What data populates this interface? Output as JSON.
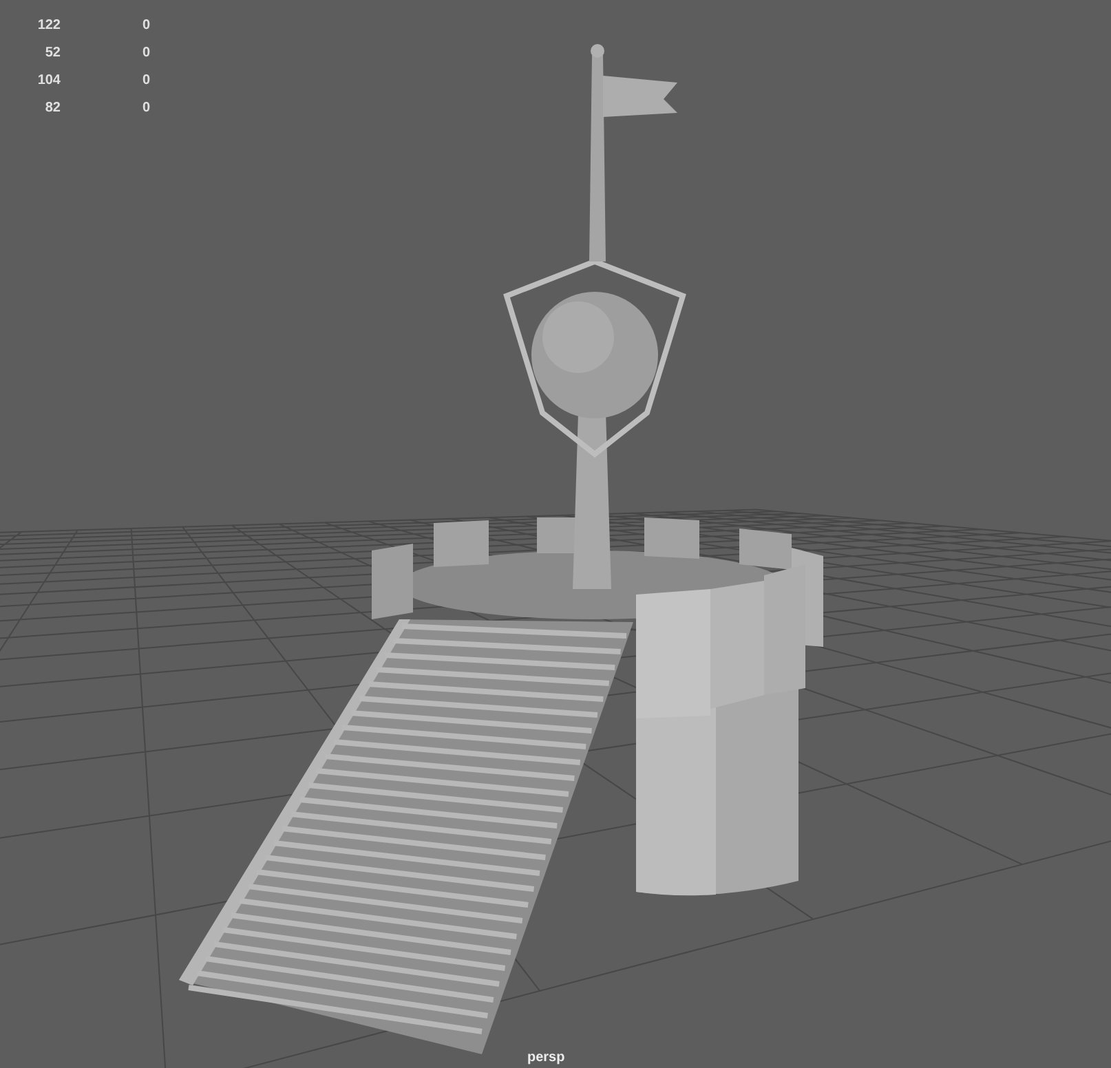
{
  "hud": {
    "rows": [
      {
        "column_1": "122",
        "column_2": "0"
      },
      {
        "column_1": "52",
        "column_2": "0"
      },
      {
        "column_1": "104",
        "column_2": "0"
      },
      {
        "column_1": "82",
        "column_2": "0"
      }
    ]
  },
  "camera_label": "persp"
}
